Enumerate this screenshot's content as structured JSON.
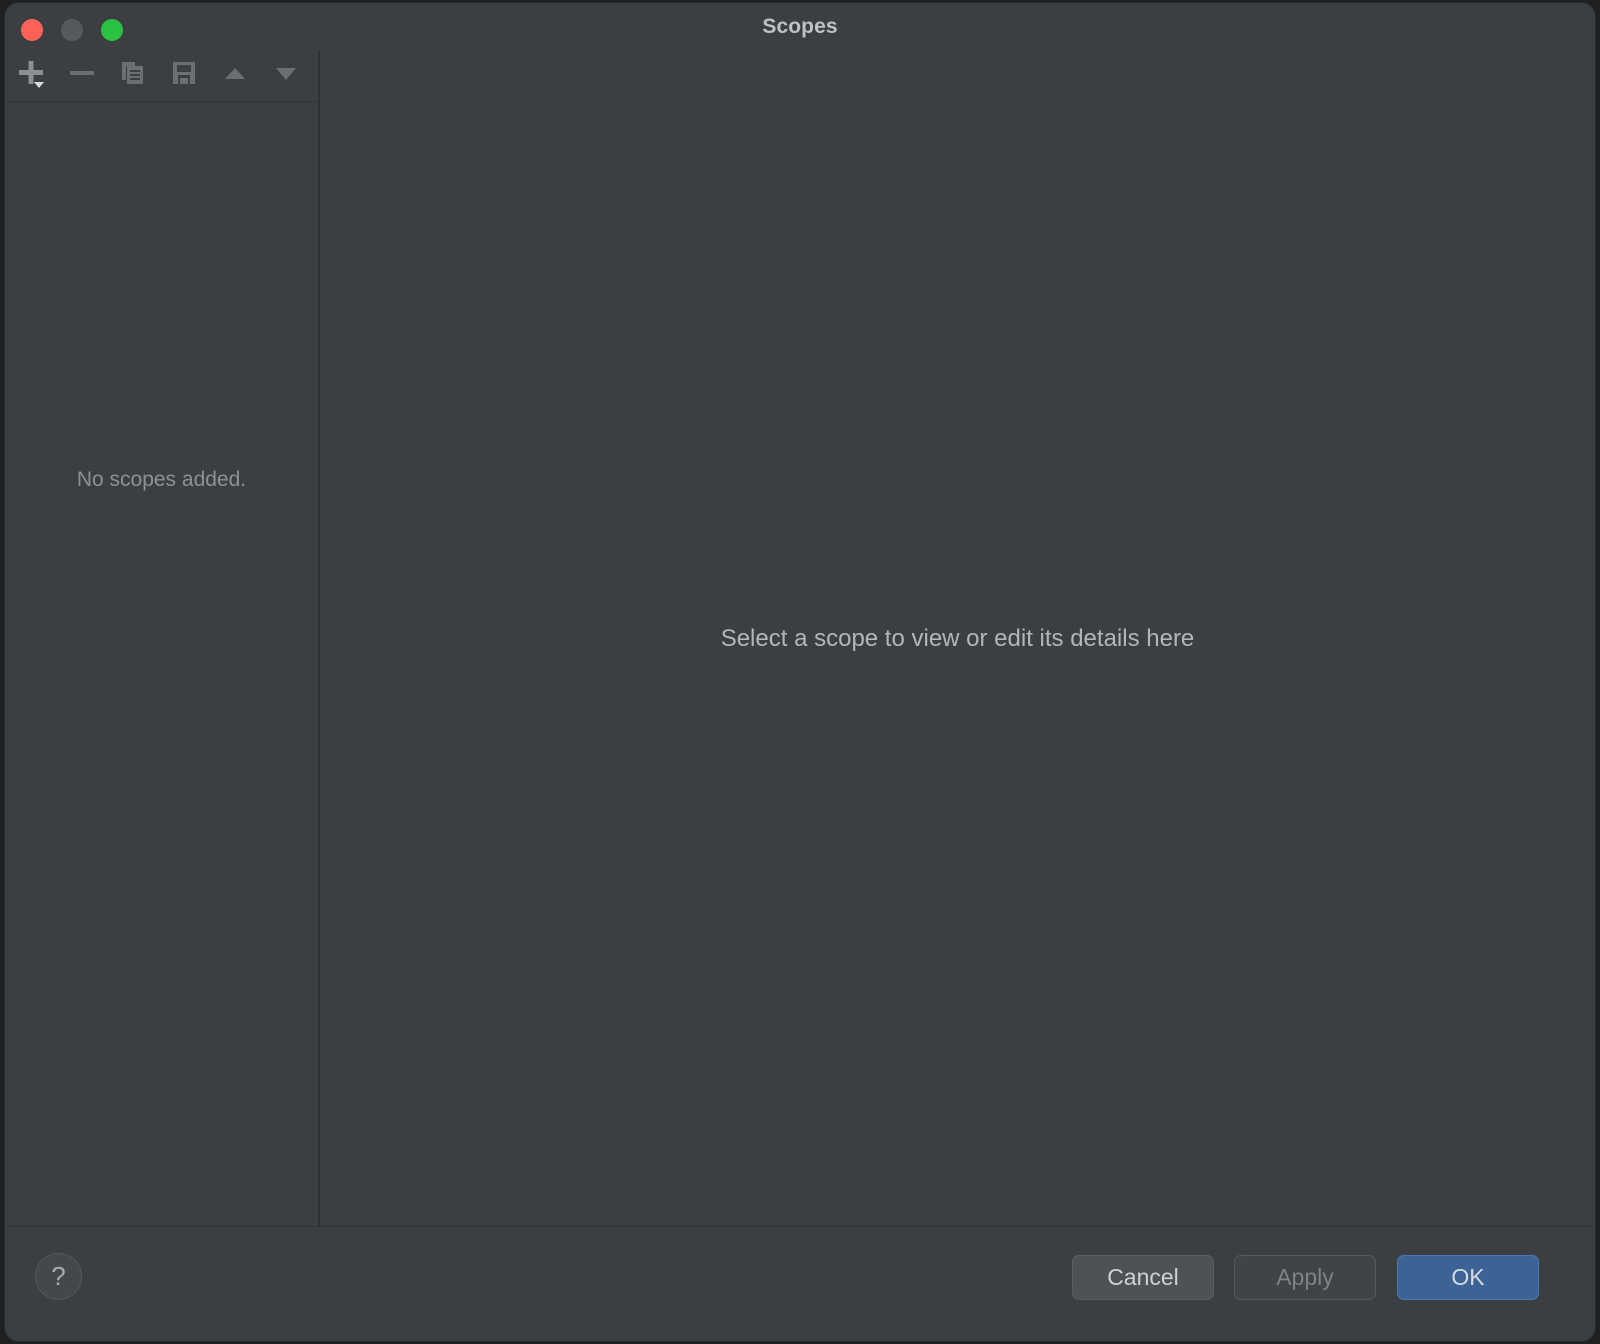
{
  "window": {
    "title": "Scopes",
    "traffic_lights": [
      {
        "name": "close",
        "color": "#ff6259"
      },
      {
        "name": "minimize",
        "color": "#565a5c"
      },
      {
        "name": "zoom",
        "color": "#2ac241"
      }
    ]
  },
  "toolbar": {
    "buttons": [
      {
        "name": "add-scope",
        "icon": "plus-dropdown-icon",
        "enabled": true
      },
      {
        "name": "remove-scope",
        "icon": "minus-icon",
        "enabled": false
      },
      {
        "name": "duplicate-scope",
        "icon": "copy-icon",
        "enabled": false
      },
      {
        "name": "save-scope",
        "icon": "save-icon",
        "enabled": false
      },
      {
        "name": "move-up",
        "icon": "triangle-up-icon",
        "enabled": false
      },
      {
        "name": "move-down",
        "icon": "triangle-down-icon",
        "enabled": false
      }
    ]
  },
  "left_panel": {
    "empty_message": "No scopes added."
  },
  "right_panel": {
    "placeholder_message": "Select a scope to view or edit its details here"
  },
  "footer": {
    "help_label": "?",
    "cancel_label": "Cancel",
    "apply_label": "Apply",
    "ok_label": "OK"
  },
  "colors": {
    "window_background": "#3c3f41",
    "divider": "#2e3133",
    "ok_accent": "#3c6396",
    "text_primary": "#bfc2c4",
    "text_muted": "#8d9193",
    "icon": "#8b8f91"
  }
}
